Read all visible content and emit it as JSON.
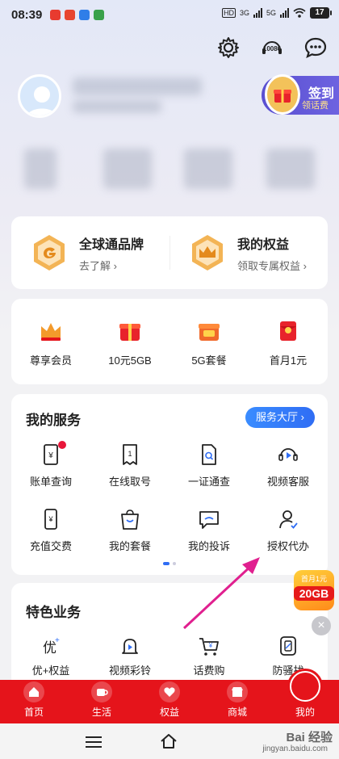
{
  "status": {
    "time": "08:39",
    "net_hd": "HD",
    "net1": "3G",
    "net2": "5G",
    "battery": "17"
  },
  "header": {
    "service_number": "10086",
    "sign": {
      "title": "签到",
      "subtitle": "领话费"
    }
  },
  "brand": [
    {
      "title": "全球通品牌",
      "subtitle": "去了解 ›"
    },
    {
      "title": "我的权益",
      "subtitle": "领取专属权益 ›"
    }
  ],
  "promos": [
    {
      "label": "尊享会员",
      "icon": "crown-icon"
    },
    {
      "label": "10元5GB",
      "icon": "red-gift-icon"
    },
    {
      "label": "5G套餐",
      "icon": "5g-gift-icon"
    },
    {
      "label": "首月1元",
      "icon": "red-envelope-icon"
    }
  ],
  "services": {
    "title": "我的服务",
    "hall_button": "服务大厅 ›",
    "items": [
      {
        "label": "账单查询",
        "icon": "bill-icon"
      },
      {
        "label": "在线取号",
        "icon": "ticket-icon"
      },
      {
        "label": "一证通查",
        "icon": "doc-search-icon"
      },
      {
        "label": "视频客服",
        "icon": "headset-icon"
      },
      {
        "label": "充值交费",
        "icon": "phone-yuan-icon"
      },
      {
        "label": "我的套餐",
        "icon": "bag-icon"
      },
      {
        "label": "我的投诉",
        "icon": "complaint-icon"
      },
      {
        "label": "授权代办",
        "icon": "user-check-icon"
      }
    ]
  },
  "features": {
    "title": "特色业务",
    "items": [
      {
        "label": "优+权益"
      },
      {
        "label": "视频彩铃"
      },
      {
        "label": "话费购"
      },
      {
        "label": "防骚扰"
      }
    ]
  },
  "float_ad": {
    "line1": "首月1元",
    "line2": "20GB"
  },
  "tabs": [
    {
      "label": "首页"
    },
    {
      "label": "生活"
    },
    {
      "label": "权益"
    },
    {
      "label": "商城"
    },
    {
      "label": "我的"
    }
  ],
  "watermark": {
    "brand": "Bai 经验",
    "url": "jingyan.baidu.com"
  },
  "colors": {
    "brand_red": "#e5141b",
    "accent_blue": "#2f6df4",
    "gold": "#f0a93a"
  }
}
